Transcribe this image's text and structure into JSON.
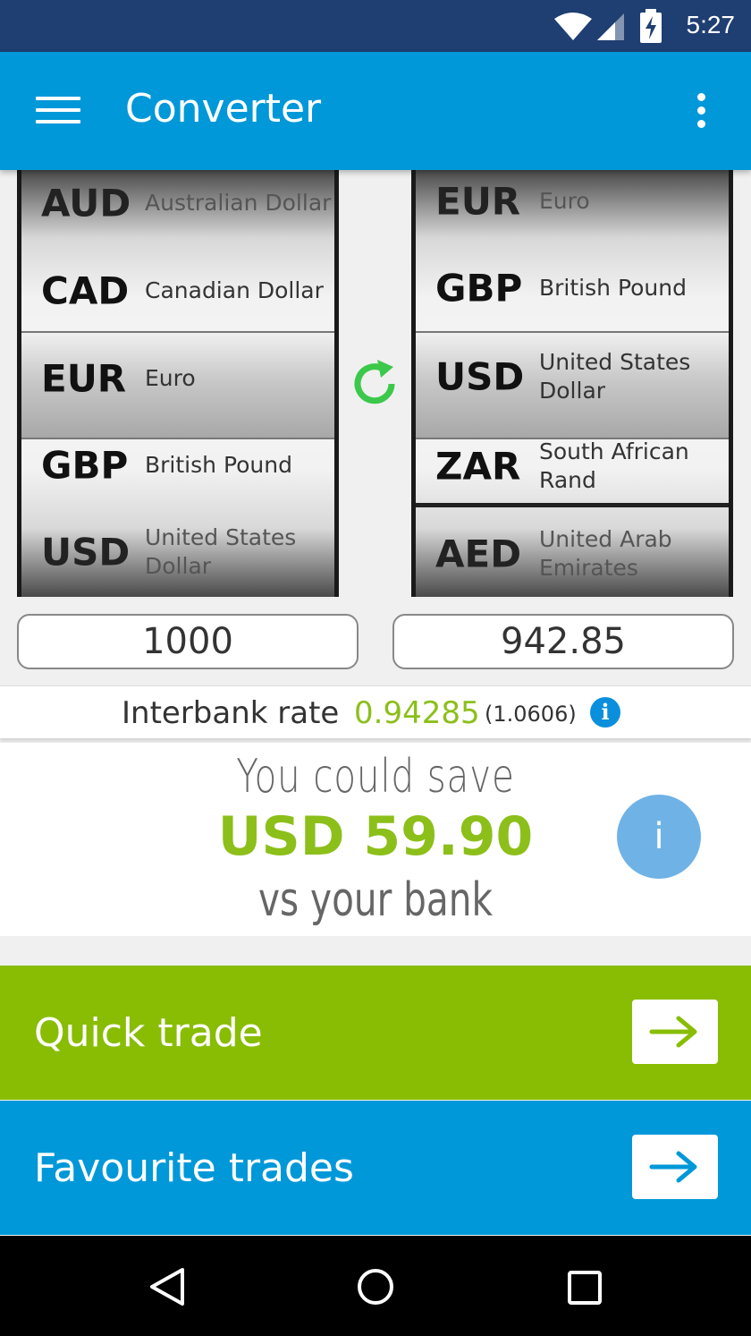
{
  "status_bar": {
    "time": "5:27"
  },
  "app_bar": {
    "title": "Converter"
  },
  "from_picker": {
    "rows": [
      {
        "code": "AUD",
        "name": "Australian Dollar"
      },
      {
        "code": "CAD",
        "name": "Canadian Dollar"
      },
      {
        "code": "EUR",
        "name": "Euro"
      },
      {
        "code": "GBP",
        "name": "British Pound"
      },
      {
        "code": "USD",
        "name": "United States Dollar"
      }
    ],
    "selected": "EUR"
  },
  "to_picker": {
    "rows": [
      {
        "code": "EUR",
        "name": "Euro"
      },
      {
        "code": "GBP",
        "name": "British Pound"
      },
      {
        "code": "USD",
        "name": "United States Dollar"
      },
      {
        "code": "ZAR",
        "name": "South African Rand"
      },
      {
        "code": "AED",
        "name": "United Arab Emirates"
      }
    ],
    "selected": "USD"
  },
  "amounts": {
    "from": "1000",
    "to": "942.85"
  },
  "rate": {
    "label": "Interbank rate",
    "value": "0.94285",
    "inverse": "(1.0606)"
  },
  "savings": {
    "line1": "You could save",
    "amount": "USD 59.90",
    "line3": "vs your bank",
    "info": "i"
  },
  "actions": {
    "quick_trade": "Quick trade",
    "favourite_trades": "Favourite trades"
  },
  "colors": {
    "primary": "#0098d8",
    "accent_green": "#88bd04",
    "status_bar": "#1f3e72"
  }
}
